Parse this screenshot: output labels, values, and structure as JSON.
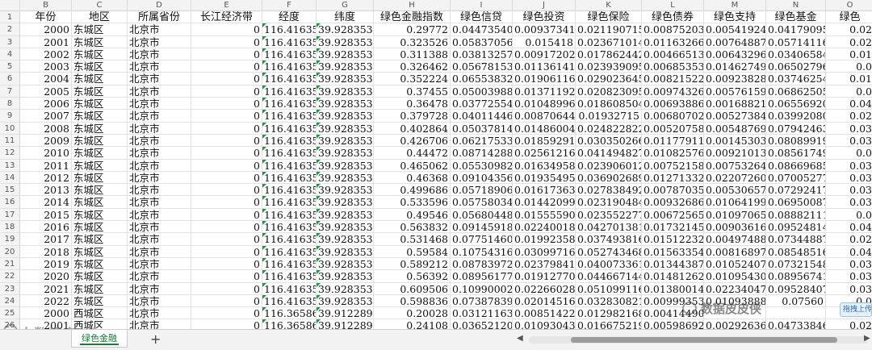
{
  "columns": [
    {
      "letter": "B",
      "header": "年份"
    },
    {
      "letter": "C",
      "header": "地区"
    },
    {
      "letter": "D",
      "header": "所属省份"
    },
    {
      "letter": "E",
      "header": "长江经济带"
    },
    {
      "letter": "F",
      "header": "经度"
    },
    {
      "letter": "G",
      "header": "纬度"
    },
    {
      "letter": "H",
      "header": "绿色金融指数"
    },
    {
      "letter": "I",
      "header": "绿色信贷"
    },
    {
      "letter": "J",
      "header": "绿色投资"
    },
    {
      "letter": "K",
      "header": "绿色保险"
    },
    {
      "letter": "L",
      "header": "绿色债券"
    },
    {
      "letter": "M",
      "header": "绿色支持"
    },
    {
      "letter": "N",
      "header": "绿色基金"
    },
    {
      "letter": "O",
      "header": "绿色"
    }
  ],
  "rows": [
    [
      "2000",
      "东城区",
      "北京市",
      "0",
      "116.416357",
      "39.928353",
      "0.29772",
      "0.044735407",
      "0.00937341",
      "0.021190715",
      "0.008752035",
      "0.005419247",
      "0.041790956",
      "0.02"
    ],
    [
      "2001",
      "东城区",
      "北京市",
      "0",
      "116.416357",
      "39.928353",
      "0.323526",
      "0.058370561",
      "0.015418",
      "0.023671014",
      "0.011632669",
      "0.007648878",
      "0.057141162",
      "0.02"
    ],
    [
      "2002",
      "东城区",
      "北京市",
      "0",
      "116.416357",
      "39.928353",
      "0.311388",
      "0.038132574",
      "0.009172028",
      "0.017862442",
      "0.004665139",
      "0.006432965",
      "0.034065847",
      "0.01"
    ],
    [
      "2003",
      "东城区",
      "北京市",
      "0",
      "116.416357",
      "39.928353",
      "0.326462",
      "0.056781536",
      "0.011361417",
      "0.023939095",
      "0.006853531",
      "0.014627491",
      "0.065027966",
      "0.0"
    ],
    [
      "2004",
      "东城区",
      "北京市",
      "0",
      "116.416357",
      "39.928353",
      "0.352224",
      "0.06553832",
      "0.019061165",
      "0.029023645",
      "0.008215228",
      "0.009238282",
      "0.037462545",
      "0.01"
    ],
    [
      "2005",
      "东城区",
      "北京市",
      "0",
      "116.416357",
      "39.928353",
      "0.37455",
      "0.05003988",
      "0.013711928",
      "0.020823095",
      "0.009743265",
      "0.005761592",
      "0.068625051",
      "0.0"
    ],
    [
      "2006",
      "东城区",
      "北京市",
      "0",
      "116.416357",
      "39.928353",
      "0.36478",
      "0.037725548",
      "0.010489966",
      "0.018608504",
      "0.00693886",
      "0.001688218",
      "0.065569205",
      "0.04"
    ],
    [
      "2007",
      "东城区",
      "北京市",
      "0",
      "116.416357",
      "39.928353",
      "0.379728",
      "0.040114466",
      "0.008706444",
      "0.01932715",
      "0.006807024",
      "0.005273849",
      "0.039920805",
      "0.02"
    ],
    [
      "2008",
      "东城区",
      "北京市",
      "0",
      "116.416357",
      "39.928353",
      "0.402864",
      "0.050378143",
      "0.014860041",
      "0.024822822",
      "0.005207589",
      "0.005487691",
      "0.079424638",
      "0.03"
    ],
    [
      "2009",
      "东城区",
      "北京市",
      "0",
      "116.416357",
      "39.928353",
      "0.426706",
      "0.062175331",
      "0.018592911",
      "0.030350266",
      "0.011779117",
      "0.001453037",
      "0.080899191",
      "0.03"
    ],
    [
      "2010",
      "东城区",
      "北京市",
      "0",
      "116.416357",
      "39.928353",
      "0.44472",
      "0.087142884",
      "0.025612165",
      "0.041494827",
      "0.01082576",
      "0.009210131",
      "0.085617494",
      "0.0"
    ],
    [
      "2011",
      "东城区",
      "北京市",
      "0",
      "116.416357",
      "39.928353",
      "0.465062",
      "0.055309824",
      "0.016349584",
      "0.023906012",
      "0.007521583",
      "0.007532645",
      "0.086696858",
      "0.03"
    ],
    [
      "2012",
      "东城区",
      "北京市",
      "0",
      "116.416357",
      "39.928353",
      "0.46368",
      "0.091043568",
      "0.019354952",
      "0.036902689",
      "0.012713324",
      "0.022072603",
      "0.070052774",
      "0.03"
    ],
    [
      "2013",
      "东城区",
      "北京市",
      "0",
      "116.416357",
      "39.928353",
      "0.499686",
      "0.057189063",
      "0.016173639",
      "0.027838492",
      "0.007870359",
      "0.005306573",
      "0.072924175",
      "0.03"
    ],
    [
      "2014",
      "东城区",
      "北京市",
      "0",
      "116.416357",
      "39.928353",
      "0.533596",
      "0.057580344",
      "0.014420997",
      "0.023190484",
      "0.009326864",
      "0.010641999",
      "0.069500879",
      "0.03"
    ],
    [
      "2015",
      "东城区",
      "北京市",
      "0",
      "116.416357",
      "39.928353",
      "0.49546",
      "0.056804489",
      "0.015555909",
      "0.023552277",
      "0.006725651",
      "0.010970651",
      "0.08882111",
      "0.0"
    ],
    [
      "2016",
      "东城区",
      "北京市",
      "0",
      "116.416357",
      "39.928353",
      "0.563832",
      "0.091459189",
      "0.022400185",
      "0.042701381",
      "0.017321456",
      "0.009036168",
      "0.09524814",
      "0.04"
    ],
    [
      "2017",
      "东城区",
      "北京市",
      "0",
      "116.416357",
      "39.928353",
      "0.531468",
      "0.077514608",
      "0.01992358",
      "0.037493816",
      "0.015122325",
      "0.004974888",
      "0.073448878",
      "0.02"
    ],
    [
      "2018",
      "东城区",
      "北京市",
      "0",
      "116.416357",
      "39.928353",
      "0.59584",
      "0.107543162",
      "0.030997165",
      "0.052743468",
      "0.015633549",
      "0.008168979",
      "0.085485165",
      "0.04"
    ],
    [
      "2019",
      "东城区",
      "北京市",
      "0",
      "116.416357",
      "39.928353",
      "0.589212",
      "0.087839725",
      "0.023798417",
      "0.040073361",
      "0.01344387",
      "0.010524077",
      "0.073215483",
      "0.03"
    ],
    [
      "2020",
      "东城区",
      "北京市",
      "0",
      "116.416357",
      "39.928353",
      "0.56392",
      "0.089561774",
      "0.019127708",
      "0.044667144",
      "0.014812622",
      "0.010954301",
      "0.089567414",
      "0.03"
    ],
    [
      "2021",
      "东城区",
      "北京市",
      "0",
      "116.416357",
      "39.928353",
      "0.609506",
      "0.109900027",
      "0.022660287",
      "0.051099116",
      "0.013800146",
      "0.022340477",
      "0.095284073",
      "0.03"
    ],
    [
      "2022",
      "东城区",
      "北京市",
      "0",
      "116.416357",
      "39.928353",
      "0.598836",
      "0.073878397",
      "0.020145161",
      "0.032830821",
      "0.009993531",
      "0.010938884",
      "0.07560",
      "0.0"
    ],
    [
      "2000",
      "西城区",
      "北京市",
      "0",
      "116.365868",
      "39.912289",
      "0.20028",
      "0.031211635",
      "0.008514222",
      "0.012982168",
      "0.00414490",
      "",
      "",
      ""
    ],
    [
      "2001",
      "西城区",
      "北京市",
      "0",
      "116.365868",
      "39.912289",
      "0.24108",
      "0.036521209",
      "0.010930433",
      "0.016675219",
      "0.00598692",
      "0.00292636",
      "0.047338469",
      "0.02"
    ]
  ],
  "sheet_tab": "绿色金融",
  "add_sheet": "+",
  "watermark_left": "大数据查",
  "watermark_right": "数据皮皮侠",
  "drag_upload": "拖拽上传"
}
